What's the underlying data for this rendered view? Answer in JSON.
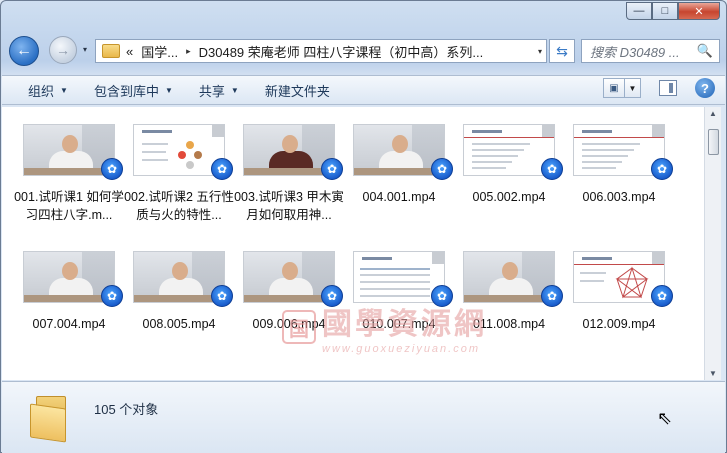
{
  "window": {
    "minimize_glyph": "—",
    "maximize_glyph": "□",
    "close_glyph": "✕"
  },
  "nav": {
    "back_glyph": "←",
    "forward_glyph": "→",
    "history_drop": "▾",
    "overflow": "«",
    "crumb_1": "国学...",
    "crumb_sep": "▸",
    "crumb_2": "D30489 荣庵老师 四柱八字课程（初中高）系列...",
    "address_drop": "▾",
    "refresh_glyph": "⇆",
    "search_placeholder": "搜索 D30489 ...",
    "search_glyph": "🔍"
  },
  "toolbar": {
    "organize": "组织",
    "include_library": "包含到库中",
    "share": "共享",
    "new_folder": "新建文件夹",
    "view_glyph": "▣",
    "help_glyph": "?"
  },
  "files": [
    {
      "name": "001.试听课1 如何学习四柱八字.m...",
      "kind": "video"
    },
    {
      "name": "002.试听课2 五行性质与火的特性...",
      "kind": "slide-circles"
    },
    {
      "name": "003.试听课3 甲木寅月如何取用神...",
      "kind": "video-dark"
    },
    {
      "name": "004.001.mp4",
      "kind": "video"
    },
    {
      "name": "005.002.mp4",
      "kind": "slide-text"
    },
    {
      "name": "006.003.mp4",
      "kind": "slide-text"
    },
    {
      "name": "007.004.mp4",
      "kind": "video"
    },
    {
      "name": "008.005.mp4",
      "kind": "video"
    },
    {
      "name": "009.006.mp4",
      "kind": "video"
    },
    {
      "name": "010.007.mp4",
      "kind": "slide-table"
    },
    {
      "name": "011.008.mp4",
      "kind": "video"
    },
    {
      "name": "012.009.mp4",
      "kind": "slide-star"
    }
  ],
  "watermark": {
    "seal": "国",
    "text": "國學資源網",
    "url": "www.guoxueziyuan.com"
  },
  "status": {
    "count": "105 个对象"
  },
  "colors": {
    "accent": "#1557c8",
    "chrome": "#cfdff1"
  },
  "icons": {
    "badge": "media-player-badge-icon"
  }
}
